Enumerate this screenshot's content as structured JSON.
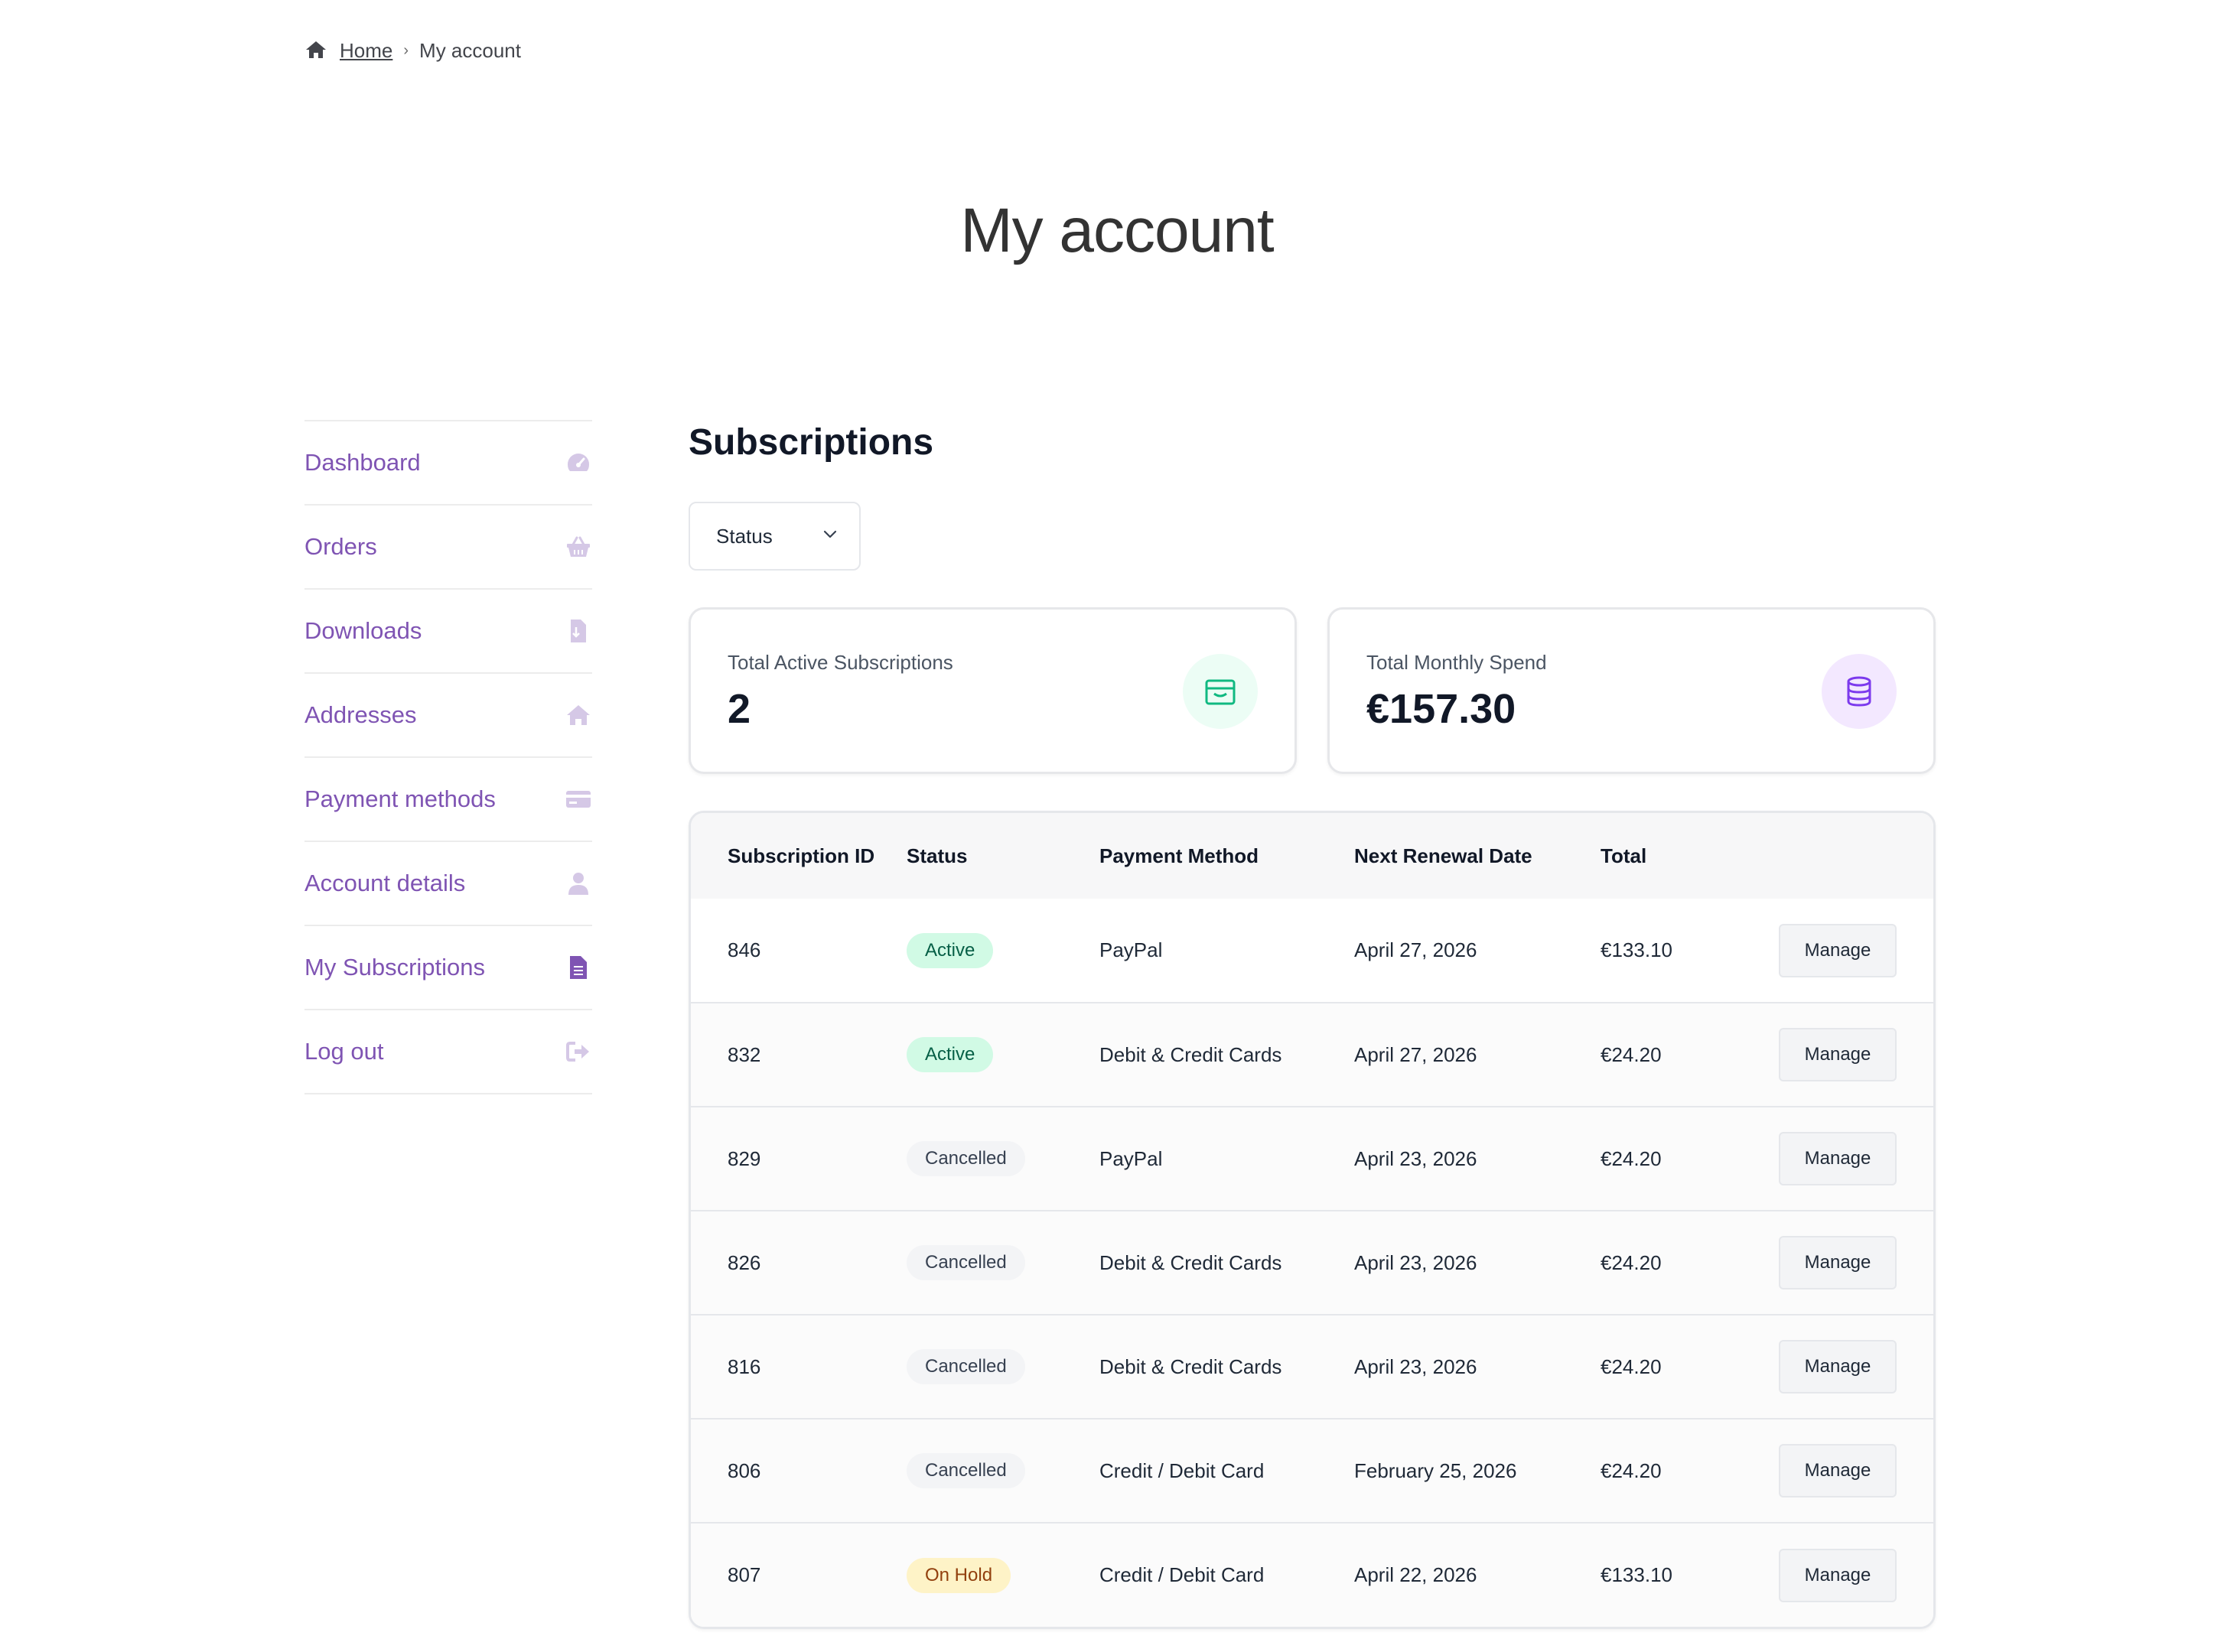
{
  "breadcrumb": {
    "home": "Home",
    "separator": "›",
    "current": "My account"
  },
  "page_title": "My account",
  "sidebar": {
    "items": [
      {
        "label": "Dashboard",
        "icon": "gauge-icon",
        "active": false
      },
      {
        "label": "Orders",
        "icon": "basket-icon",
        "active": false
      },
      {
        "label": "Downloads",
        "icon": "file-download-icon",
        "active": false
      },
      {
        "label": "Addresses",
        "icon": "home-icon",
        "active": false
      },
      {
        "label": "Payment methods",
        "icon": "credit-card-icon",
        "active": false
      },
      {
        "label": "Account details",
        "icon": "user-icon",
        "active": false
      },
      {
        "label": "My Subscriptions",
        "icon": "document-icon",
        "active": true
      },
      {
        "label": "Log out",
        "icon": "sign-out-icon",
        "active": false
      }
    ]
  },
  "main": {
    "title": "Subscriptions",
    "status_filter": {
      "selected": "Status"
    },
    "cards": [
      {
        "label": "Total Active Subscriptions",
        "value": "2",
        "icon": "wallet-icon",
        "color": "#10b981"
      },
      {
        "label": "Total Monthly Spend",
        "value": "€157.30",
        "icon": "database-icon",
        "color": "#7c3aed"
      }
    ],
    "table": {
      "headers": [
        "Subscription ID",
        "Status",
        "Payment Method",
        "Next Renewal Date",
        "Total",
        ""
      ],
      "manage_label": "Manage",
      "rows": [
        {
          "id": "846",
          "status": "Active",
          "status_type": "active",
          "method": "PayPal",
          "renewal": "April 27, 2026",
          "total": "€133.10"
        },
        {
          "id": "832",
          "status": "Active",
          "status_type": "active",
          "method": "Debit & Credit Cards",
          "renewal": "April 27, 2026",
          "total": "€24.20"
        },
        {
          "id": "829",
          "status": "Cancelled",
          "status_type": "cancelled",
          "method": "PayPal",
          "renewal": "April 23, 2026",
          "total": "€24.20"
        },
        {
          "id": "826",
          "status": "Cancelled",
          "status_type": "cancelled",
          "method": "Debit & Credit Cards",
          "renewal": "April 23, 2026",
          "total": "€24.20"
        },
        {
          "id": "816",
          "status": "Cancelled",
          "status_type": "cancelled",
          "method": "Debit & Credit Cards",
          "renewal": "April 23, 2026",
          "total": "€24.20"
        },
        {
          "id": "806",
          "status": "Cancelled",
          "status_type": "cancelled",
          "method": "Credit / Debit Card",
          "renewal": "February 25, 2026",
          "total": "€24.20"
        },
        {
          "id": "807",
          "status": "On Hold",
          "status_type": "hold",
          "method": "Credit / Debit Card",
          "renewal": "April 22, 2026",
          "total": "€133.10"
        }
      ]
    }
  },
  "colors": {
    "accent": "#7f54b3",
    "icon_muted": "#d5c8e6",
    "icon_active": "#7f54b3"
  }
}
